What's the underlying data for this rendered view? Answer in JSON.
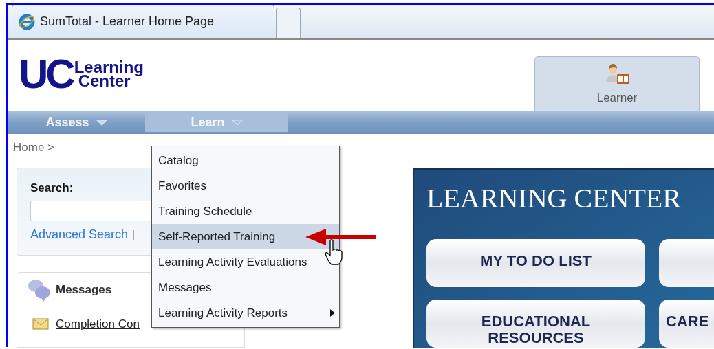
{
  "browser_tab": {
    "title": "SumTotal - Learner Home Page"
  },
  "header": {
    "logo": {
      "mark": "UC",
      "line1": "Learning",
      "line2": "Center"
    },
    "role_tab": {
      "label": "Learner",
      "selected": true
    }
  },
  "nav": [
    {
      "label": "Assess",
      "selected": false
    },
    {
      "label": "Learn",
      "selected": true
    }
  ],
  "breadcrumb": "Home >",
  "search": {
    "label": "Search:",
    "link": "Advanced Search",
    "separator": "|"
  },
  "messages": {
    "title": "Messages",
    "items": [
      "Completion Con"
    ]
  },
  "menu": {
    "items": [
      {
        "label": "Catalog",
        "selected": false,
        "submenu": false
      },
      {
        "label": "Favorites",
        "selected": false,
        "submenu": false
      },
      {
        "label": "Training Schedule",
        "selected": false,
        "submenu": false
      },
      {
        "label": "Self-Reported Training",
        "selected": true,
        "submenu": false
      },
      {
        "label": "Learning Activity Evaluations",
        "selected": false,
        "submenu": false
      },
      {
        "label": "Messages",
        "selected": false,
        "submenu": false
      },
      {
        "label": "Learning Activity Reports",
        "selected": false,
        "submenu": true
      }
    ]
  },
  "banner": {
    "title": "LEARNING CENTER",
    "buttons": [
      {
        "kind": "labeled",
        "label": "MY TO DO LIST"
      },
      {
        "kind": "blank"
      },
      {
        "kind": "labeled",
        "label": "EDUCATIONAL RESOURCES"
      },
      {
        "kind": "labeled",
        "label": "CARE"
      }
    ]
  }
}
